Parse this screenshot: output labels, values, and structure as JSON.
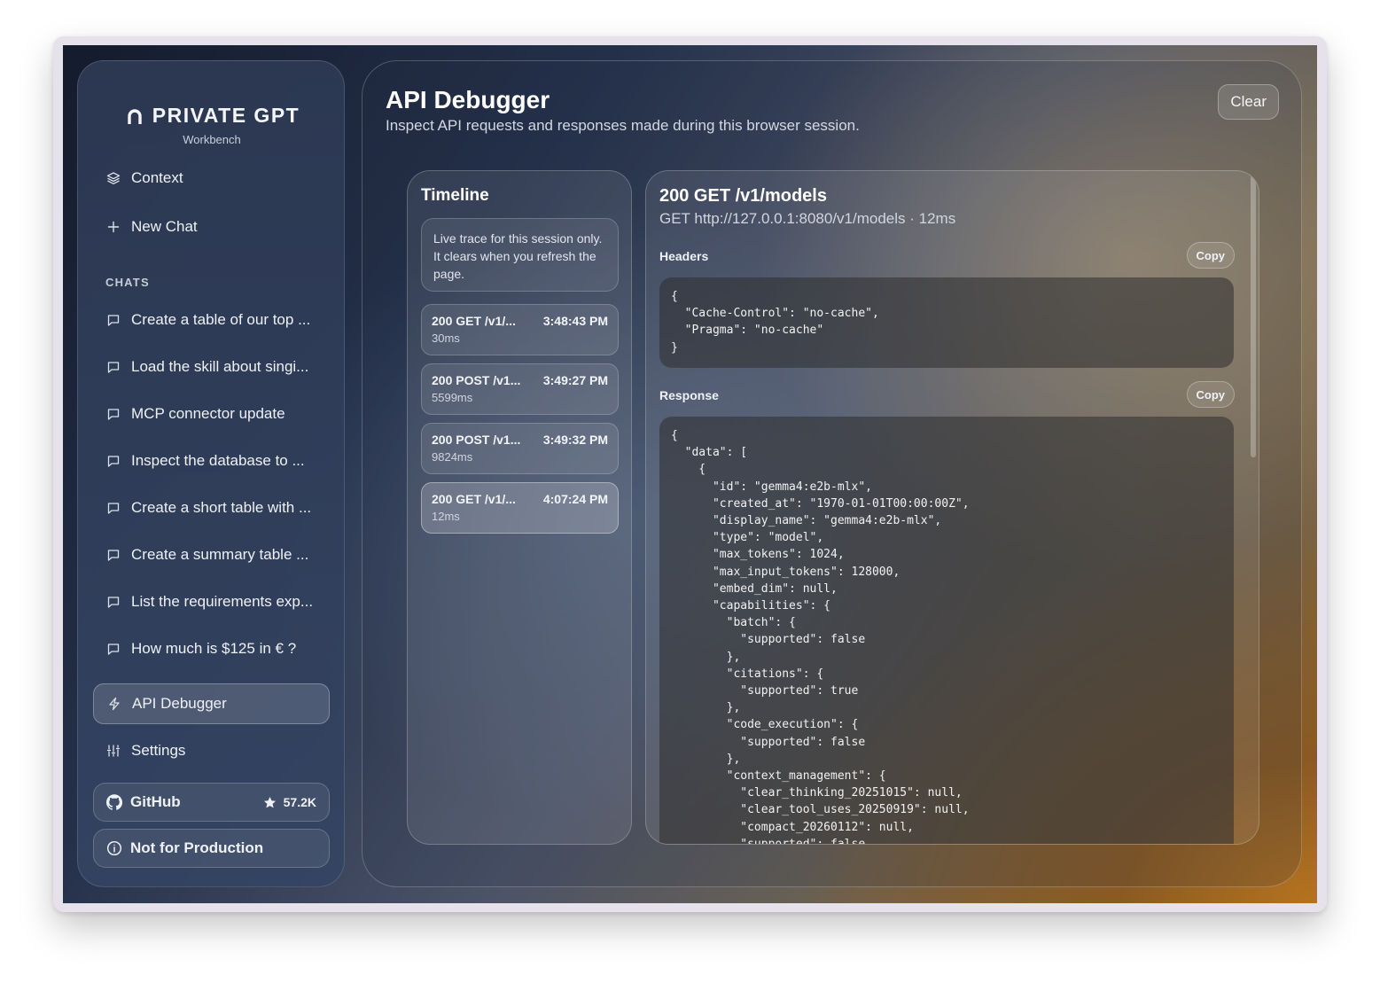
{
  "brand": {
    "title": "PRIVATE GPT",
    "subtitle": "Workbench"
  },
  "sidebar": {
    "context_label": "Context",
    "new_chat_label": "New Chat",
    "chats_label": "CHATS",
    "chats": [
      "Create a table of our top ...",
      "Load the skill about singi...",
      "MCP connector update",
      "Inspect the database to ...",
      "Create a short table with ...",
      "Create a summary table ...",
      "List the requirements exp...",
      "How much is $125 in € ?"
    ],
    "api_debugger_label": "API Debugger",
    "settings_label": "Settings",
    "github_label": "GitHub",
    "github_stars": "57.2K",
    "notice_label": "Not for Production"
  },
  "main": {
    "title": "API Debugger",
    "subtitle": "Inspect API requests and responses made during this browser session.",
    "clear_label": "Clear"
  },
  "timeline": {
    "title": "Timeline",
    "note": "Live trace for this session only. It clears when you refresh the page.",
    "entries": [
      {
        "label": "200 GET /v1/...",
        "time": "3:48:43 PM",
        "duration": "30ms"
      },
      {
        "label": "200 POST /v1...",
        "time": "3:49:27 PM",
        "duration": "5599ms"
      },
      {
        "label": "200 POST /v1...",
        "time": "3:49:32 PM",
        "duration": "9824ms"
      },
      {
        "label": "200 GET /v1/...",
        "time": "4:07:24 PM",
        "duration": "12ms"
      }
    ]
  },
  "detail": {
    "title": "200 GET /v1/models",
    "subtitle": "GET http://127.0.0.1:8080/v1/models · 12ms",
    "headers_label": "Headers",
    "response_label": "Response",
    "copy_label": "Copy",
    "headers_code": "{\n  \"Cache-Control\": \"no-cache\",\n  \"Pragma\": \"no-cache\"\n}",
    "response_code": "{\n  \"data\": [\n    {\n      \"id\": \"gemma4:e2b-mlx\",\n      \"created_at\": \"1970-01-01T00:00:00Z\",\n      \"display_name\": \"gemma4:e2b-mlx\",\n      \"type\": \"model\",\n      \"max_tokens\": 1024,\n      \"max_input_tokens\": 128000,\n      \"embed_dim\": null,\n      \"capabilities\": {\n        \"batch\": {\n          \"supported\": false\n        },\n        \"citations\": {\n          \"supported\": true\n        },\n        \"code_execution\": {\n          \"supported\": false\n        },\n        \"context_management\": {\n          \"clear_thinking_20251015\": null,\n          \"clear_tool_uses_20250919\": null,\n          \"compact_20260112\": null,\n          \"supported\": false"
  }
}
